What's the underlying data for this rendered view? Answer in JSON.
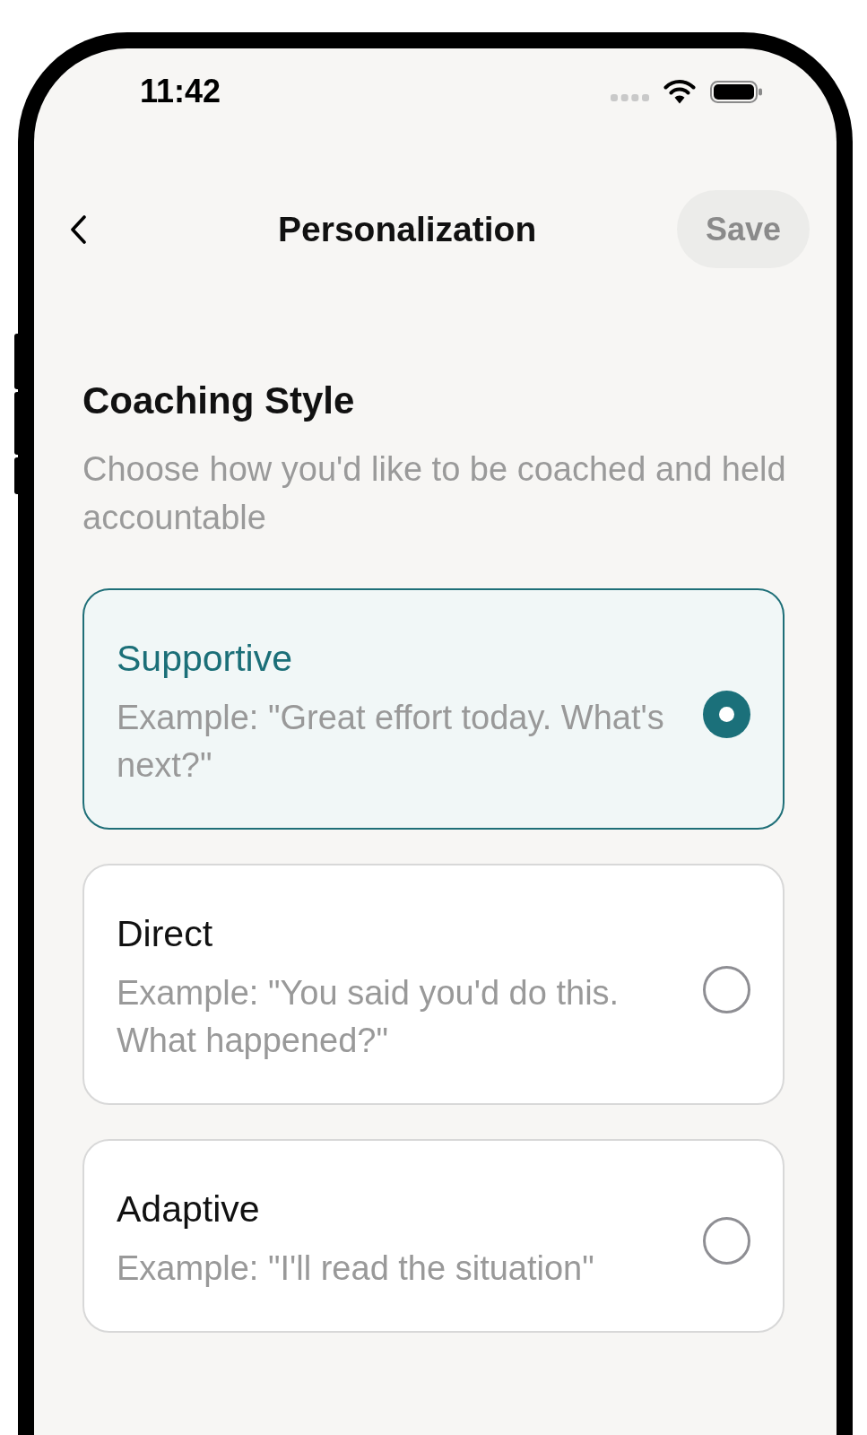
{
  "status_bar": {
    "time": "11:42"
  },
  "header": {
    "title": "Personalization",
    "save_button": {
      "label": "Save",
      "disabled": true
    }
  },
  "section": {
    "title": "Coaching Style",
    "subtitle": "Choose how you'd like to be coached and held accountable"
  },
  "options": [
    {
      "title": "Supportive",
      "example": "Example: \"Great effort today. What's next?\"",
      "selected": true
    },
    {
      "title": "Direct",
      "example": "Example: \"You said you'd do this. What happened?\"",
      "selected": false
    },
    {
      "title": "Adaptive",
      "example": "Example: \"I'll read the situation\"",
      "selected": false
    }
  ]
}
